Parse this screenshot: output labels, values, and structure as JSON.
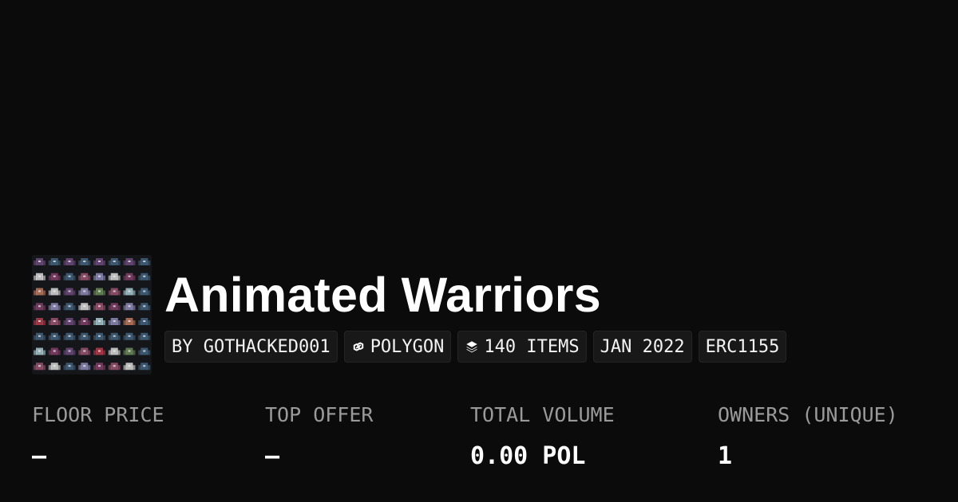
{
  "collection": {
    "title": "Animated Warriors",
    "creator": "BY GOTHACKED001",
    "chain": "POLYGON",
    "items": "140 ITEMS",
    "date": "JAN 2022",
    "standard": "ERC1155",
    "chain_icon": "polygon-chain-icon",
    "items_icon": "layers-icon"
  },
  "stats": [
    {
      "label": "FLOOR PRICE",
      "value": "–"
    },
    {
      "label": "TOP OFFER",
      "value": "–"
    },
    {
      "label": "TOTAL VOLUME",
      "value": "0.00 POL"
    },
    {
      "label": "OWNERS (UNIQUE)",
      "value": "1"
    }
  ],
  "colors": {
    "background": "#0b0b0b",
    "chip_background": "#181818",
    "label": "#9a9a9a",
    "text": "#ffffff"
  }
}
